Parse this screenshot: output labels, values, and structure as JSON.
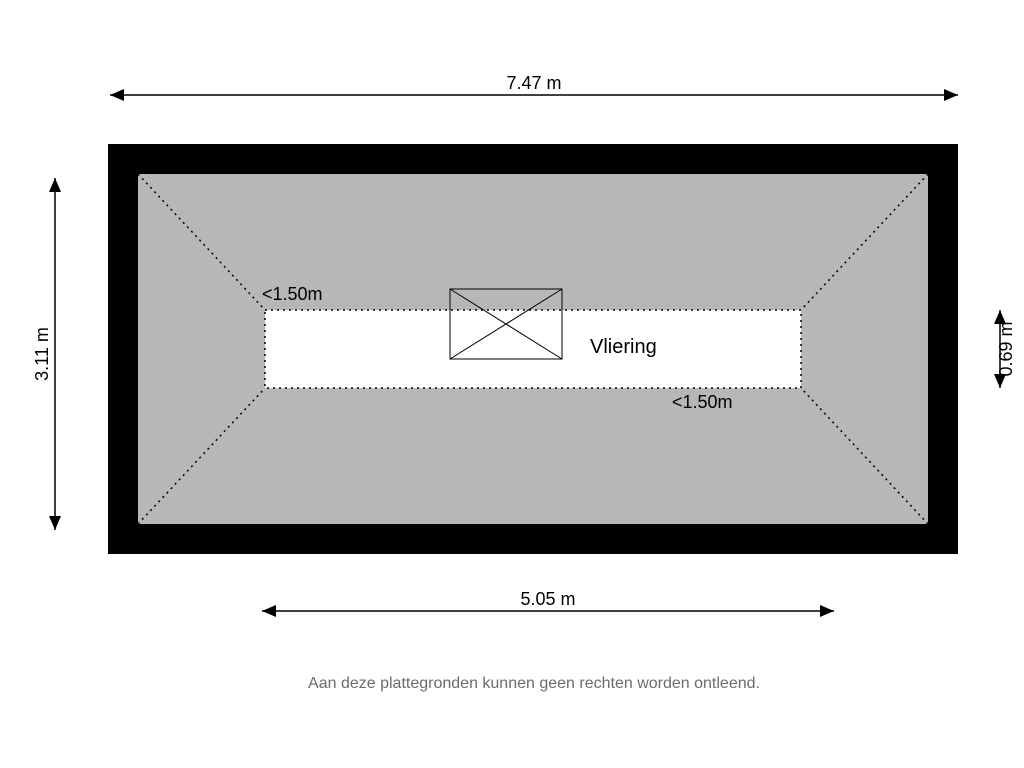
{
  "dimensions": {
    "top_width": "7.47 m",
    "bottom_width": "5.05 m",
    "left_height": "3.11 m",
    "right_height": "0.69 m"
  },
  "labels": {
    "room_name": "Vliering",
    "headroom_top": "<1.50m",
    "headroom_bottom": "<1.50m"
  },
  "footer": "Aan deze plattegronden kunnen geen rechten worden ontleend."
}
